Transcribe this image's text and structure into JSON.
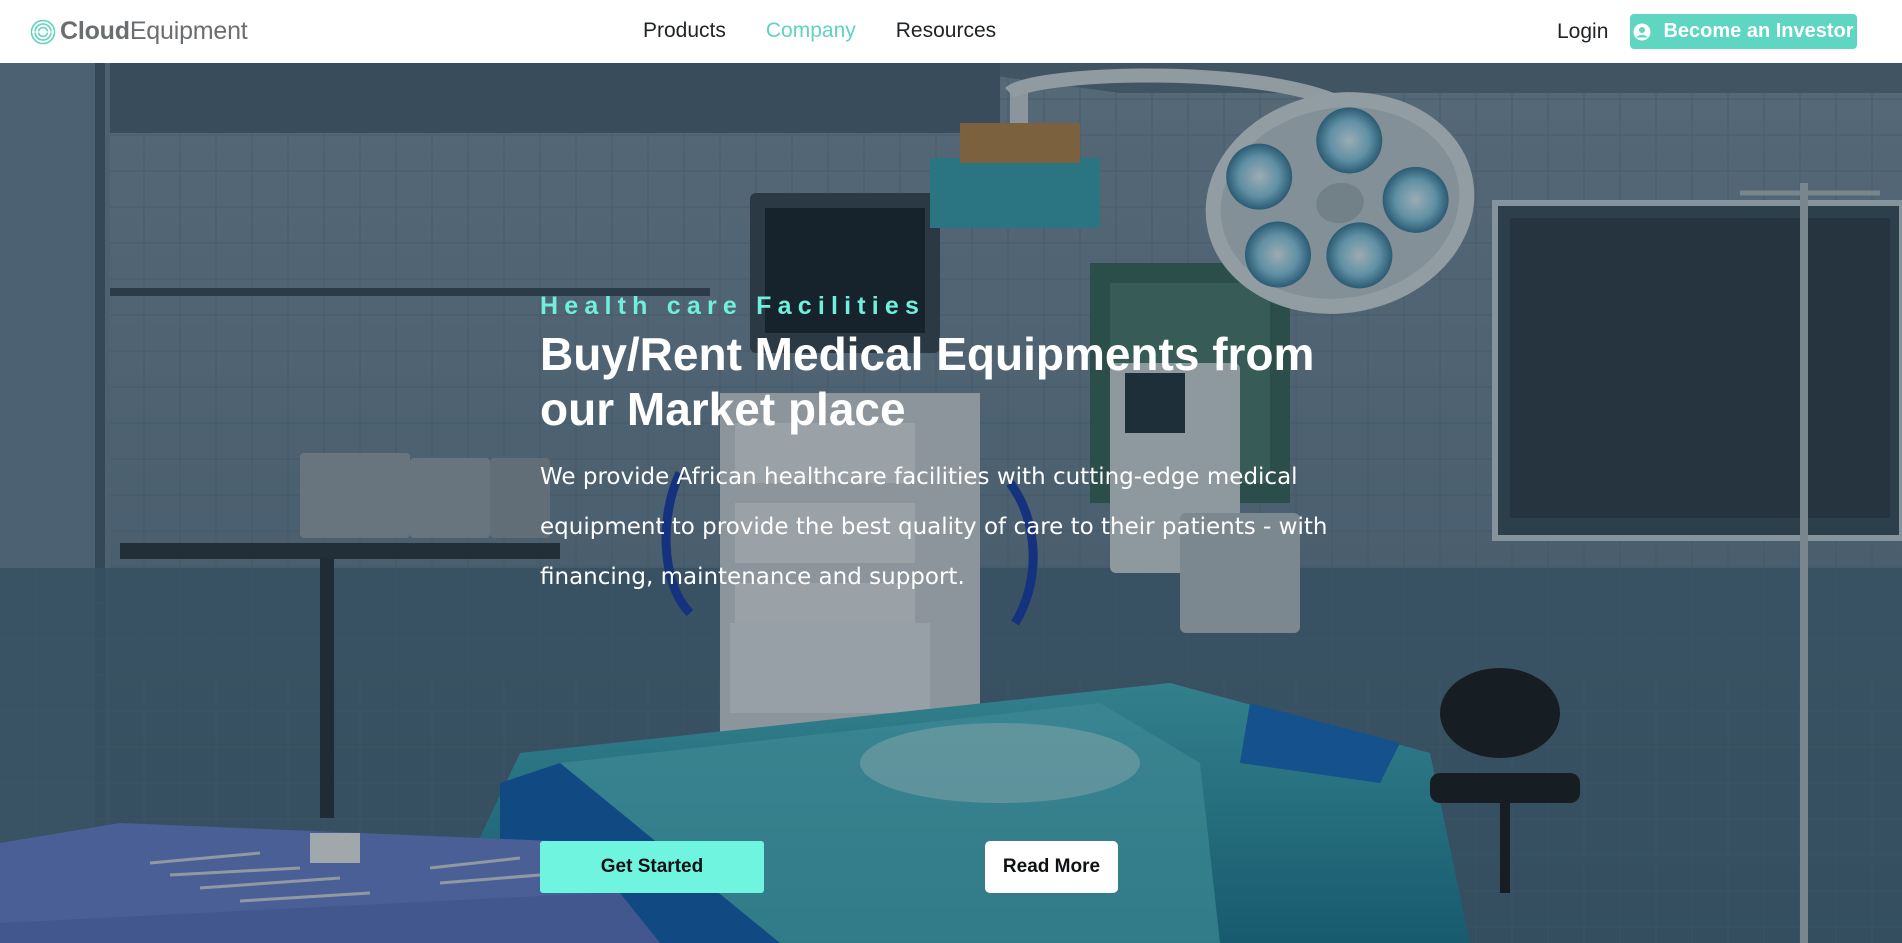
{
  "brand": {
    "name_bold": "Cloud",
    "name_light": "Equipment",
    "icon": "layered-circle-logo-icon",
    "accent_color": "#5fd3bf"
  },
  "nav": {
    "items": [
      {
        "label": "Products",
        "active": false
      },
      {
        "label": "Company",
        "active": true
      },
      {
        "label": "Resources",
        "active": false
      }
    ]
  },
  "header_actions": {
    "login_label": "Login",
    "investor_label": "Become an Investor",
    "investor_icon": "user-circle-icon",
    "investor_color": "#5ed6c2"
  },
  "hero": {
    "background": "operating-room-photo",
    "eyebrow": "Health care Facilities",
    "headline": "Buy/Rent Medical Equipments from our Market place",
    "description": "We provide African healthcare facilities with cutting-edge medical equipment to provide the best quality of care to their patients - with financing, maintenance and support.",
    "primary_cta": "Get Started",
    "secondary_cta": "Read More",
    "eyebrow_color": "#6ff0dc",
    "primary_cta_color": "#6ff5df"
  }
}
